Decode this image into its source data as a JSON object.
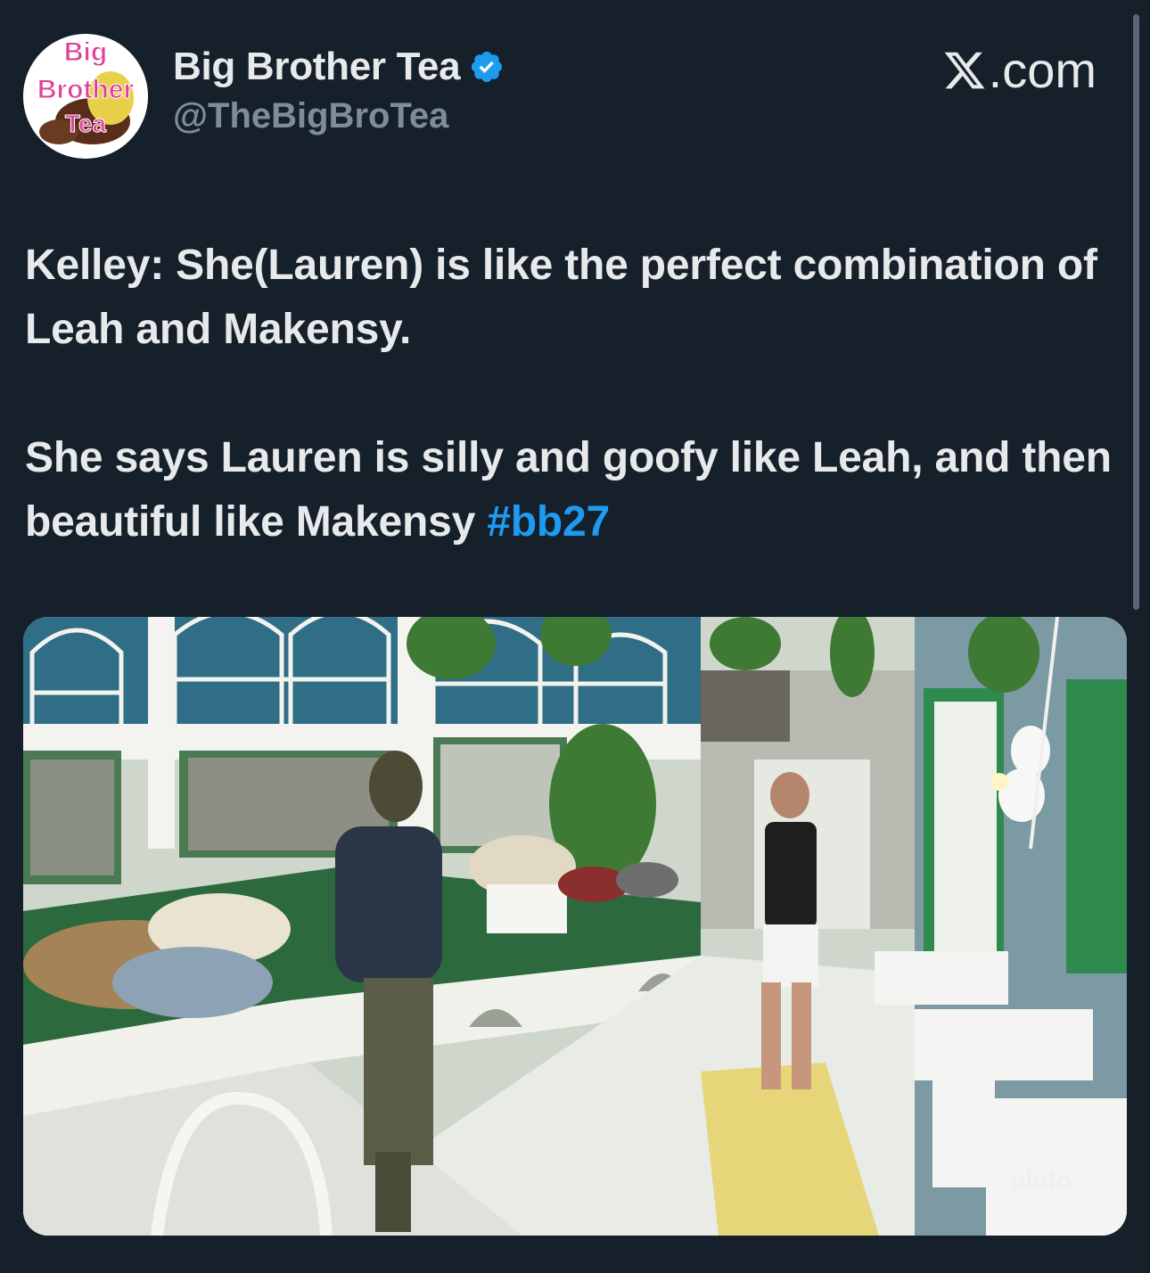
{
  "author": {
    "display_name": "Big Brother Tea",
    "handle": "@TheBigBroTea",
    "avatar_text": [
      "Big",
      "Brother",
      "Tea"
    ],
    "verified": true,
    "verified_color": "#1d9bf0",
    "avatar_icon": "avatar-logo"
  },
  "site": {
    "logo_icon": "x-logo-icon",
    "suffix": ".com"
  },
  "tweet": {
    "paragraph_1": "Kelley: She(Lauren) is like the perfect combination of Leah and Makensy.",
    "paragraph_2": "She says Lauren is silly and goofy like Leah, and then beautiful like Makensy",
    "hashtag": "#bb27",
    "hashtag_color": "#1d9bf0"
  },
  "media": {
    "watermark": "pluto"
  },
  "colors": {
    "background": "#15202b",
    "text": "#e7e9ea",
    "secondary_text": "#8b98a5"
  }
}
